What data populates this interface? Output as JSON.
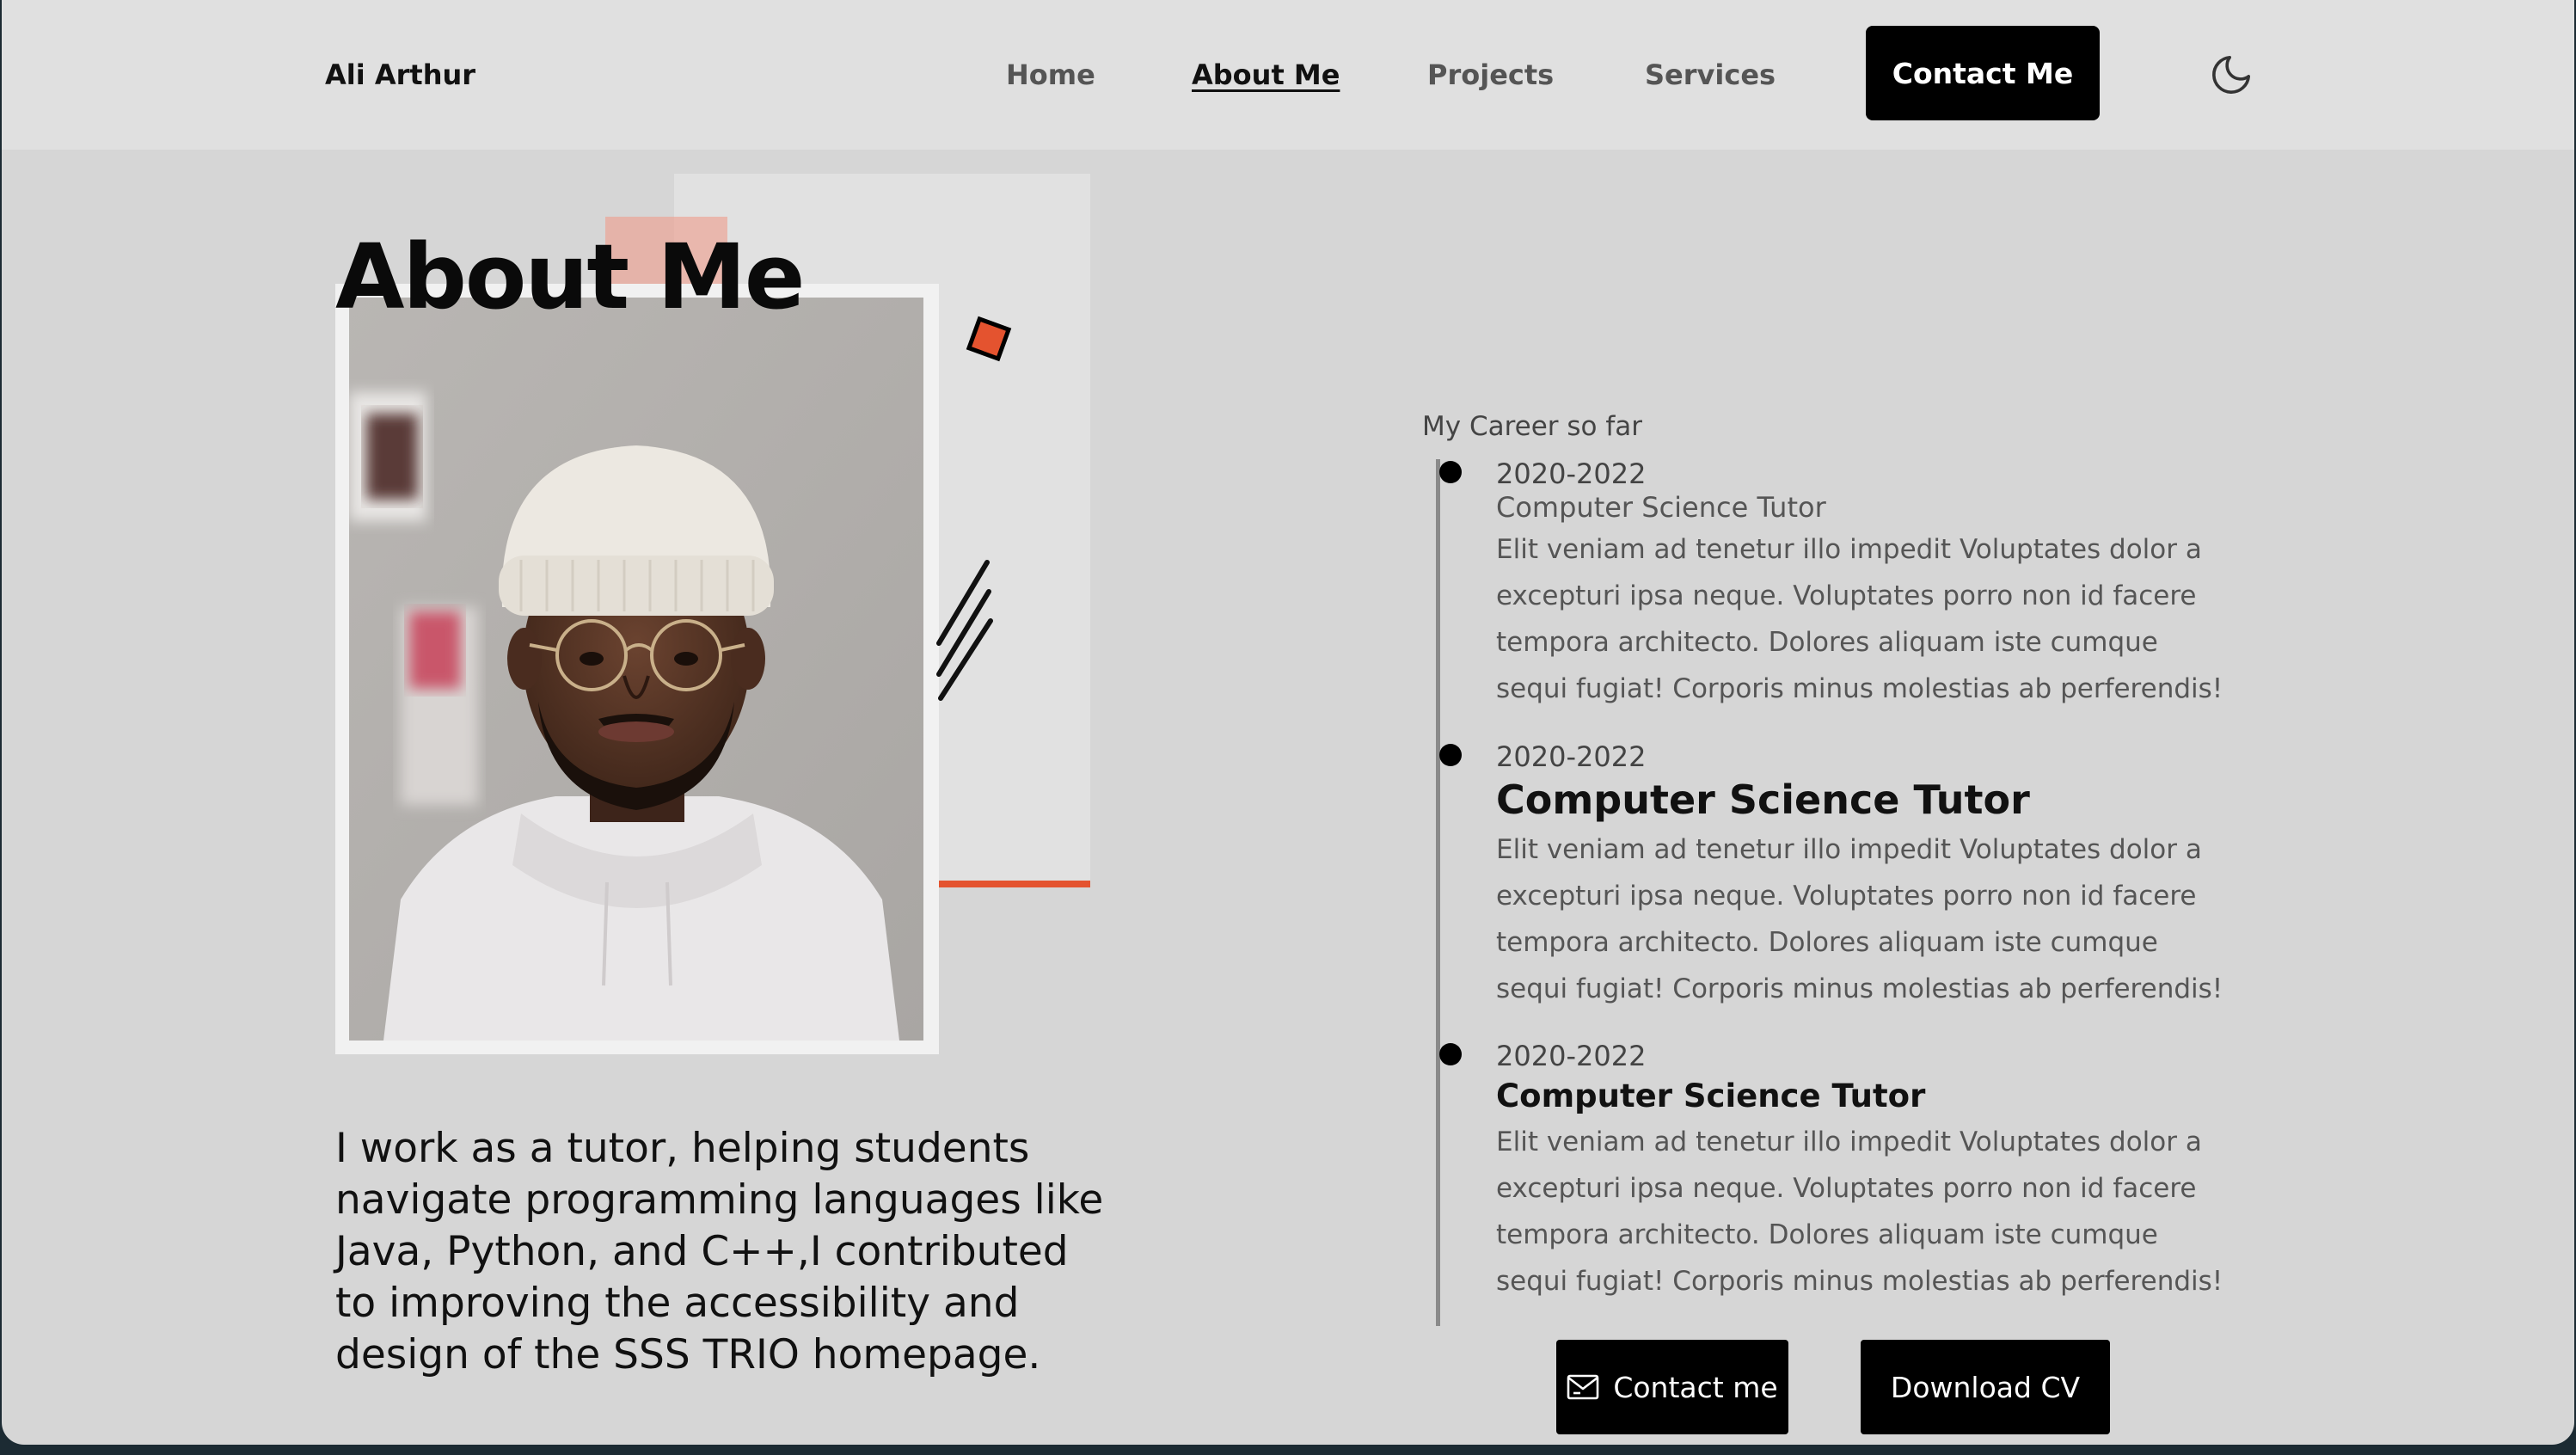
{
  "nav": {
    "logo": "Ali Arthur",
    "links": [
      {
        "label": "Home",
        "active": false
      },
      {
        "label": "About Me",
        "active": true
      },
      {
        "label": "Projects",
        "active": false
      },
      {
        "label": "Services",
        "active": false
      }
    ],
    "contact_label": "Contact Me",
    "theme_icon": "moon-icon"
  },
  "about": {
    "title": "About Me",
    "bio": "I work as a tutor, helping students navigate programming languages like Java, Python, and C++,I contributed to improving the accessibility and design of the SSS TRIO homepage."
  },
  "career": {
    "heading": "My Career so far",
    "items": [
      {
        "years": "2020-2022",
        "role": "Computer Science Tutor",
        "description": "Elit veniam ad tenetur illo impedit Voluptates dolor a excepturi ipsa neque. Voluptates porro non id facere tempora architecto. Dolores aliquam iste cumque sequi fugiat! Corporis minus molestias ab perferendis!"
      },
      {
        "years": "2020-2022",
        "role": "Computer Science Tutor",
        "description": "Elit veniam ad tenetur illo impedit Voluptates dolor a excepturi ipsa neque. Voluptates porro non id facere tempora architecto. Dolores aliquam iste cumque sequi fugiat! Corporis minus molestias ab perferendis!"
      },
      {
        "years": "2020-2022",
        "role": "Computer Science Tutor",
        "description": "Elit veniam ad tenetur illo impedit Voluptates dolor a excepturi ipsa neque. Voluptates porro non id facere tempora architecto. Dolores aliquam iste cumque sequi fugiat! Corporis minus molestias ab perferendis!"
      }
    ]
  },
  "actions": {
    "contact_label": "Contact me",
    "contact_icon": "mail-icon",
    "cv_label": "Download CV"
  },
  "colors": {
    "accent": "#e4532f",
    "background": "#d6d6d6",
    "nav_background": "#e0e0e0",
    "button": "#000000"
  }
}
